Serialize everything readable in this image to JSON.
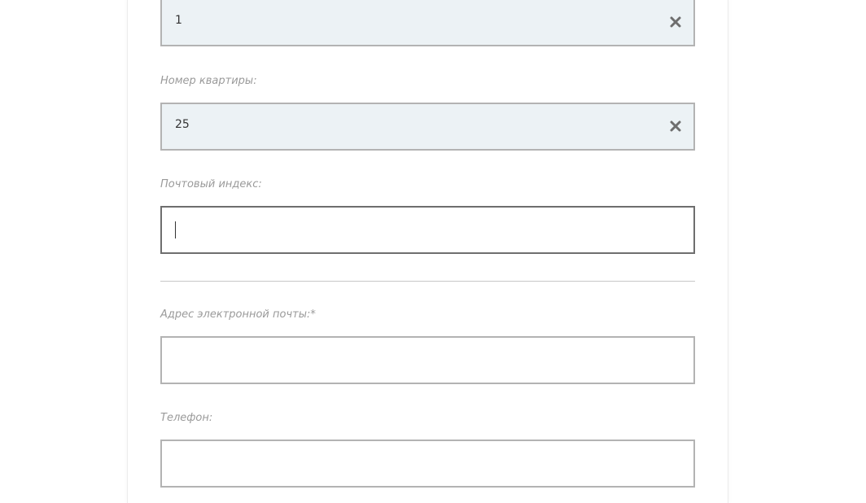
{
  "form": {
    "house_field": {
      "value": "1",
      "clear_icon": "close-icon"
    },
    "apartment": {
      "label": "Номер квартиры:",
      "value": "25",
      "clear_icon": "close-icon"
    },
    "postal_code": {
      "label": "Почтовый индекс:",
      "value": ""
    },
    "email": {
      "label": "Адрес электронной почты:*",
      "value": ""
    },
    "phone": {
      "label": "Телефон:",
      "value": ""
    }
  },
  "colors": {
    "filled_background": "#ecf2f5",
    "border": "#b3b3b3",
    "focused_border": "#6e6e6e",
    "label_text": "#9a9a9a",
    "clear_icon": "#6e6e6e"
  }
}
